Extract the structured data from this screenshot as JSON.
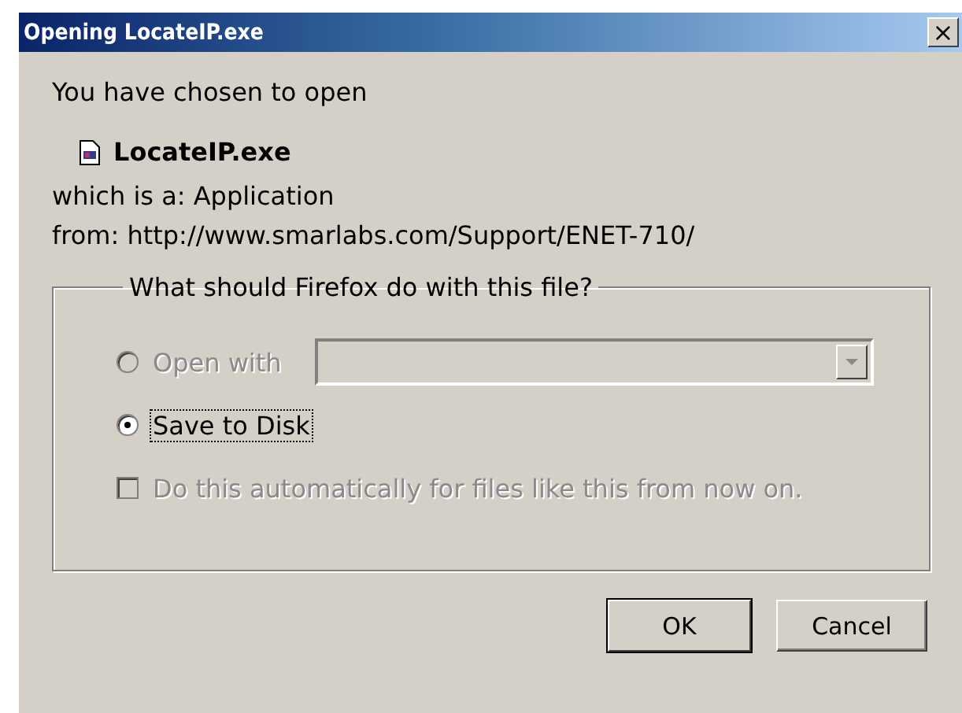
{
  "window": {
    "title": "Opening LocateIP.exe",
    "close": "×"
  },
  "intro": "You have chosen to open",
  "file": {
    "name": "LocateIP.exe"
  },
  "type_line": "which is a: Application",
  "from_line": "from: http://www.smarlabs.com/Support/ENET-710/",
  "group": {
    "legend": "What should Firefox do with this file?",
    "options": [
      {
        "kind": "radio",
        "label": "Open with",
        "selected": false,
        "disabled": true,
        "combo": {
          "disabled": true
        }
      },
      {
        "kind": "radio",
        "label": "Save to Disk",
        "selected": true,
        "disabled": false,
        "focused": true
      },
      {
        "kind": "checkbox",
        "label": "Do this automatically for files like this from now on.",
        "checked": false,
        "disabled": true
      }
    ]
  },
  "buttons": [
    {
      "label": "OK",
      "default": true
    },
    {
      "label": "Cancel",
      "default": false
    }
  ]
}
